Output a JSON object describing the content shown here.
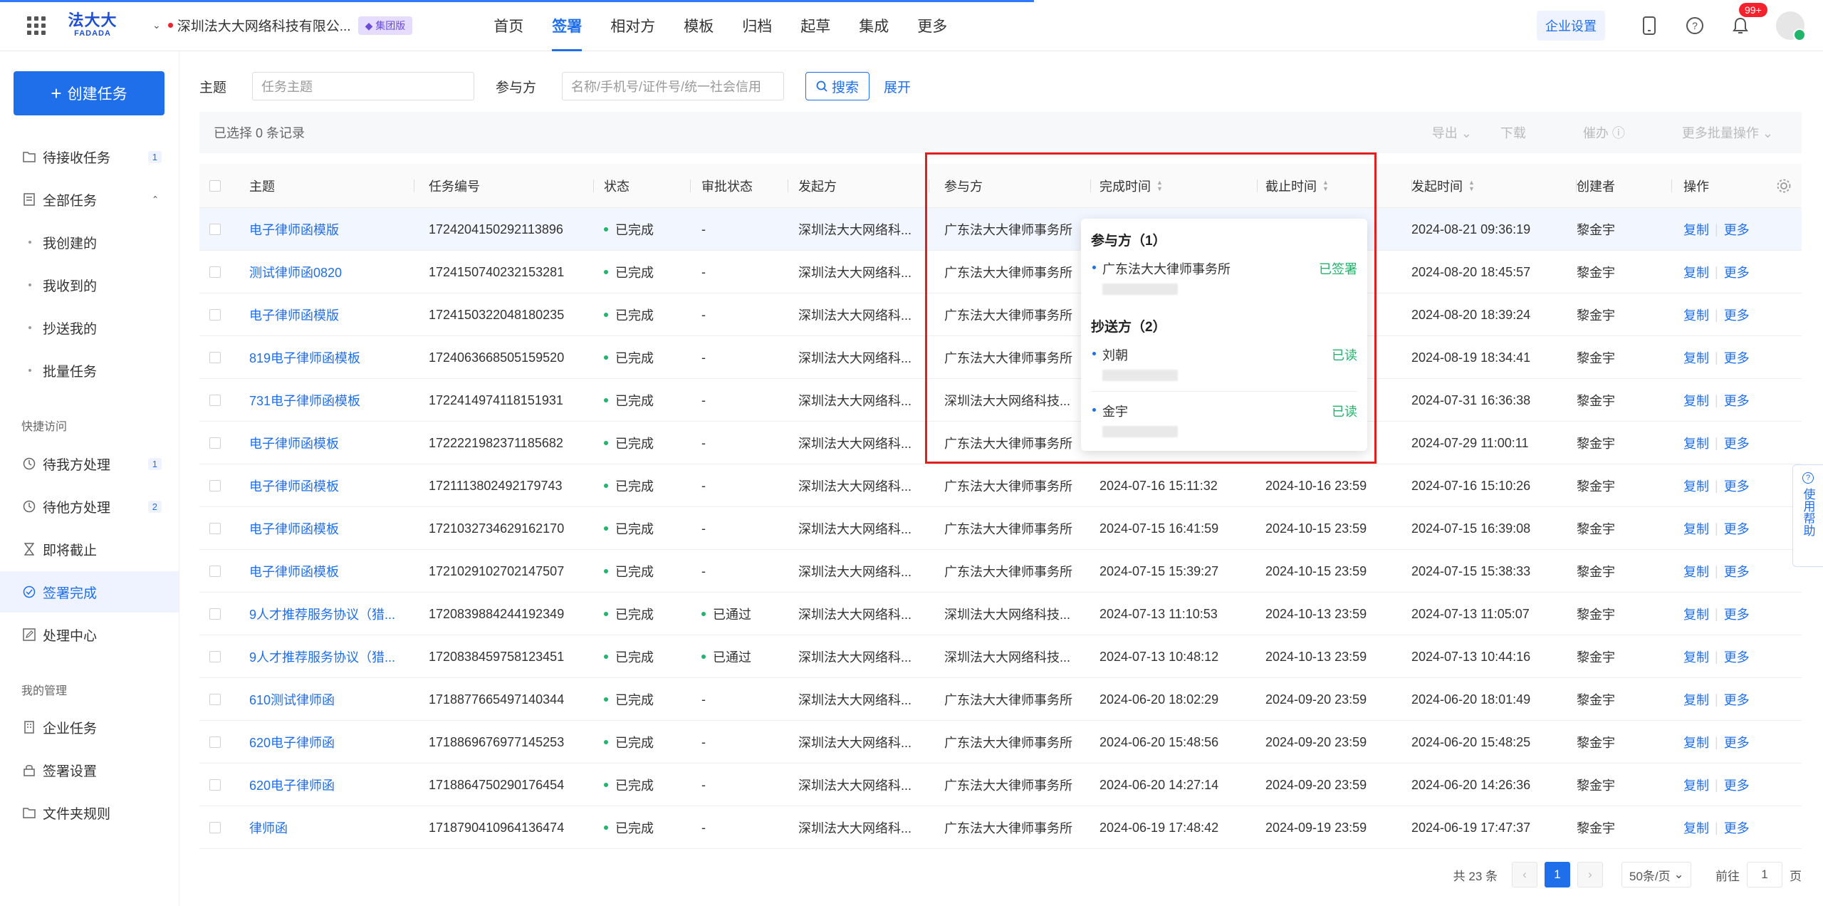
{
  "header": {
    "logo_cn": "法大大",
    "logo_en": "FADADA",
    "org_name": "深圳法大大网络科技有限公...",
    "org_badge": "集团版",
    "nav": [
      {
        "label": "首页"
      },
      {
        "label": "签署",
        "active": true
      },
      {
        "label": "相对方"
      },
      {
        "label": "模板"
      },
      {
        "label": "归档"
      },
      {
        "label": "起草"
      },
      {
        "label": "集成"
      },
      {
        "label": "更多"
      }
    ],
    "corp_settings": "企业设置",
    "notif_count": "99+"
  },
  "sidebar": {
    "create_label": "创建任务",
    "items": [
      {
        "label": "待接收任务",
        "count": "1",
        "icon": "folder-icon"
      },
      {
        "label": "全部任务",
        "icon": "document-icon"
      },
      {
        "label": "我创建的"
      },
      {
        "label": "我收到的"
      },
      {
        "label": "抄送我的"
      },
      {
        "label": "批量任务"
      }
    ],
    "section_quick": "快捷访问",
    "quick": [
      {
        "label": "待我方处理",
        "count": "1",
        "icon": "clock-icon"
      },
      {
        "label": "待他方处理",
        "count": "2",
        "icon": "clock-icon"
      },
      {
        "label": "即将截止",
        "icon": "hourglass-icon"
      },
      {
        "label": "签署完成",
        "icon": "check-circle-icon",
        "active": true
      },
      {
        "label": "处理中心",
        "icon": "edit-icon"
      }
    ],
    "section_manage": "我的管理",
    "manage": [
      {
        "label": "企业任务",
        "icon": "building-icon"
      },
      {
        "label": "签署设置",
        "icon": "lock-icon"
      },
      {
        "label": "文件夹规则",
        "icon": "folder-icon"
      }
    ]
  },
  "search": {
    "subject_label": "主题",
    "subject_placeholder": "任务主题",
    "party_label": "参与方",
    "party_placeholder": "名称/手机号/证件号/统一社会信用",
    "search_button": "搜索",
    "expand": "展开"
  },
  "selection": {
    "text": "已选择 0 条记录",
    "export": "导出",
    "download": "下载",
    "urge": "催办",
    "more_batch": "更多批量操作"
  },
  "table": {
    "columns": {
      "subject": "主题",
      "task_no": "任务编号",
      "status": "状态",
      "approval": "审批状态",
      "initiator": "发起方",
      "party": "参与方",
      "finish_time": "完成时间",
      "deadline": "截止时间",
      "start_time": "发起时间",
      "creator": "创建者",
      "action": "操作"
    },
    "action_copy": "复制",
    "action_more": "更多",
    "rows": [
      {
        "subject": "电子律师函模版",
        "task_no": "1724204150292113896",
        "status": "已完成",
        "approval": "-",
        "initiator": "深圳法大大网络科...",
        "party": "广东法大大律师事务所",
        "finish_time": "",
        "deadline": "",
        "start_time": "2024-08-21 09:36:19",
        "creator": "黎金宇"
      },
      {
        "subject": "测试律师函0820",
        "task_no": "1724150740232153281",
        "status": "已完成",
        "approval": "-",
        "initiator": "深圳法大大网络科...",
        "party": "广东法大大律师事务所",
        "finish_time": "",
        "deadline": "",
        "start_time": "2024-08-20 18:45:57",
        "creator": "黎金宇"
      },
      {
        "subject": "电子律师函模版",
        "task_no": "1724150322048180235",
        "status": "已完成",
        "approval": "-",
        "initiator": "深圳法大大网络科...",
        "party": "广东法大大律师事务所",
        "finish_time": "",
        "deadline": "",
        "start_time": "2024-08-20 18:39:24",
        "creator": "黎金宇"
      },
      {
        "subject": "819电子律师函模板",
        "task_no": "1724063668505159520",
        "status": "已完成",
        "approval": "-",
        "initiator": "深圳法大大网络科...",
        "party": "广东法大大律师事务所",
        "finish_time": "",
        "deadline": "",
        "start_time": "2024-08-19 18:34:41",
        "creator": "黎金宇"
      },
      {
        "subject": "731电子律师函模板",
        "task_no": "1722414974118151931",
        "status": "已完成",
        "approval": "-",
        "initiator": "深圳法大大网络科...",
        "party": "深圳法大大网络科技...",
        "finish_time": "",
        "deadline": "",
        "start_time": "2024-07-31 16:36:38",
        "creator": "黎金宇"
      },
      {
        "subject": "电子律师函模板",
        "task_no": "1722221982371185682",
        "status": "已完成",
        "approval": "-",
        "initiator": "深圳法大大网络科...",
        "party": "广东法大大律师事务所",
        "finish_time": "",
        "deadline": "",
        "start_time": "2024-07-29 11:00:11",
        "creator": "黎金宇"
      },
      {
        "subject": "电子律师函模板",
        "task_no": "1721113802492179743",
        "status": "已完成",
        "approval": "-",
        "initiator": "深圳法大大网络科...",
        "party": "广东法大大律师事务所",
        "finish_time": "2024-07-16 15:11:32",
        "deadline": "2024-10-16 23:59",
        "start_time": "2024-07-16 15:10:26",
        "creator": "黎金宇"
      },
      {
        "subject": "电子律师函模板",
        "task_no": "1721032734629162170",
        "status": "已完成",
        "approval": "-",
        "initiator": "深圳法大大网络科...",
        "party": "广东法大大律师事务所",
        "finish_time": "2024-07-15 16:41:59",
        "deadline": "2024-10-15 23:59",
        "start_time": "2024-07-15 16:39:08",
        "creator": "黎金宇"
      },
      {
        "subject": "电子律师函模板",
        "task_no": "1721029102702147507",
        "status": "已完成",
        "approval": "-",
        "initiator": "深圳法大大网络科...",
        "party": "广东法大大律师事务所",
        "finish_time": "2024-07-15 15:39:27",
        "deadline": "2024-10-15 23:59",
        "start_time": "2024-07-15 15:38:33",
        "creator": "黎金宇"
      },
      {
        "subject": "9人才推荐服务协议（猎...",
        "task_no": "1720839884244192349",
        "status": "已完成",
        "approval": "已通过",
        "initiator": "深圳法大大网络科...",
        "party": "深圳法大大网络科技...",
        "finish_time": "2024-07-13 11:10:53",
        "deadline": "2024-10-13 23:59",
        "start_time": "2024-07-13 11:05:07",
        "creator": "黎金宇"
      },
      {
        "subject": "9人才推荐服务协议（猎...",
        "task_no": "1720838459758123451",
        "status": "已完成",
        "approval": "已通过",
        "initiator": "深圳法大大网络科...",
        "party": "深圳法大大网络科技...",
        "finish_time": "2024-07-13 10:48:12",
        "deadline": "2024-10-13 23:59",
        "start_time": "2024-07-13 10:44:16",
        "creator": "黎金宇"
      },
      {
        "subject": "610测试律师函",
        "task_no": "1718877665497140344",
        "status": "已完成",
        "approval": "-",
        "initiator": "深圳法大大网络科...",
        "party": "广东法大大律师事务所",
        "finish_time": "2024-06-20 18:02:29",
        "deadline": "2024-09-20 23:59",
        "start_time": "2024-06-20 18:01:49",
        "creator": "黎金宇"
      },
      {
        "subject": "620电子律师函",
        "task_no": "1718869676977145253",
        "status": "已完成",
        "approval": "-",
        "initiator": "深圳法大大网络科...",
        "party": "广东法大大律师事务所",
        "finish_time": "2024-06-20 15:48:56",
        "deadline": "2024-09-20 23:59",
        "start_time": "2024-06-20 15:48:25",
        "creator": "黎金宇"
      },
      {
        "subject": "620电子律师函",
        "task_no": "1718864750290176454",
        "status": "已完成",
        "approval": "-",
        "initiator": "深圳法大大网络科...",
        "party": "广东法大大律师事务所",
        "finish_time": "2024-06-20 14:27:14",
        "deadline": "2024-09-20 23:59",
        "start_time": "2024-06-20 14:26:36",
        "creator": "黎金宇"
      },
      {
        "subject": "律师函",
        "task_no": "1718790410964136474",
        "status": "已完成",
        "approval": "-",
        "initiator": "深圳法大大网络科...",
        "party": "广东法大大律师事务所",
        "finish_time": "2024-06-19 17:48:42",
        "deadline": "2024-09-19 23:59",
        "start_time": "2024-06-19 17:47:37",
        "creator": "黎金宇"
      }
    ]
  },
  "popover": {
    "party_title": "参与方（1）",
    "parties": [
      {
        "name": "广东法大大律师事务所",
        "status": "已签署"
      }
    ],
    "cc_title": "抄送方（2）",
    "cc": [
      {
        "name": "刘朝",
        "status": "已读"
      },
      {
        "name": "金宇",
        "status": "已读"
      }
    ]
  },
  "pager": {
    "total": "共 23 条",
    "current": "1",
    "page_size": "50条/页",
    "goto_label": "前往",
    "goto_value": "1",
    "page_suffix": "页"
  },
  "help_float": "使用帮助",
  "colors": {
    "primary": "#1f6feb",
    "success": "#1fb56b",
    "danger": "#f5222d",
    "highlight": "#e0201f"
  }
}
